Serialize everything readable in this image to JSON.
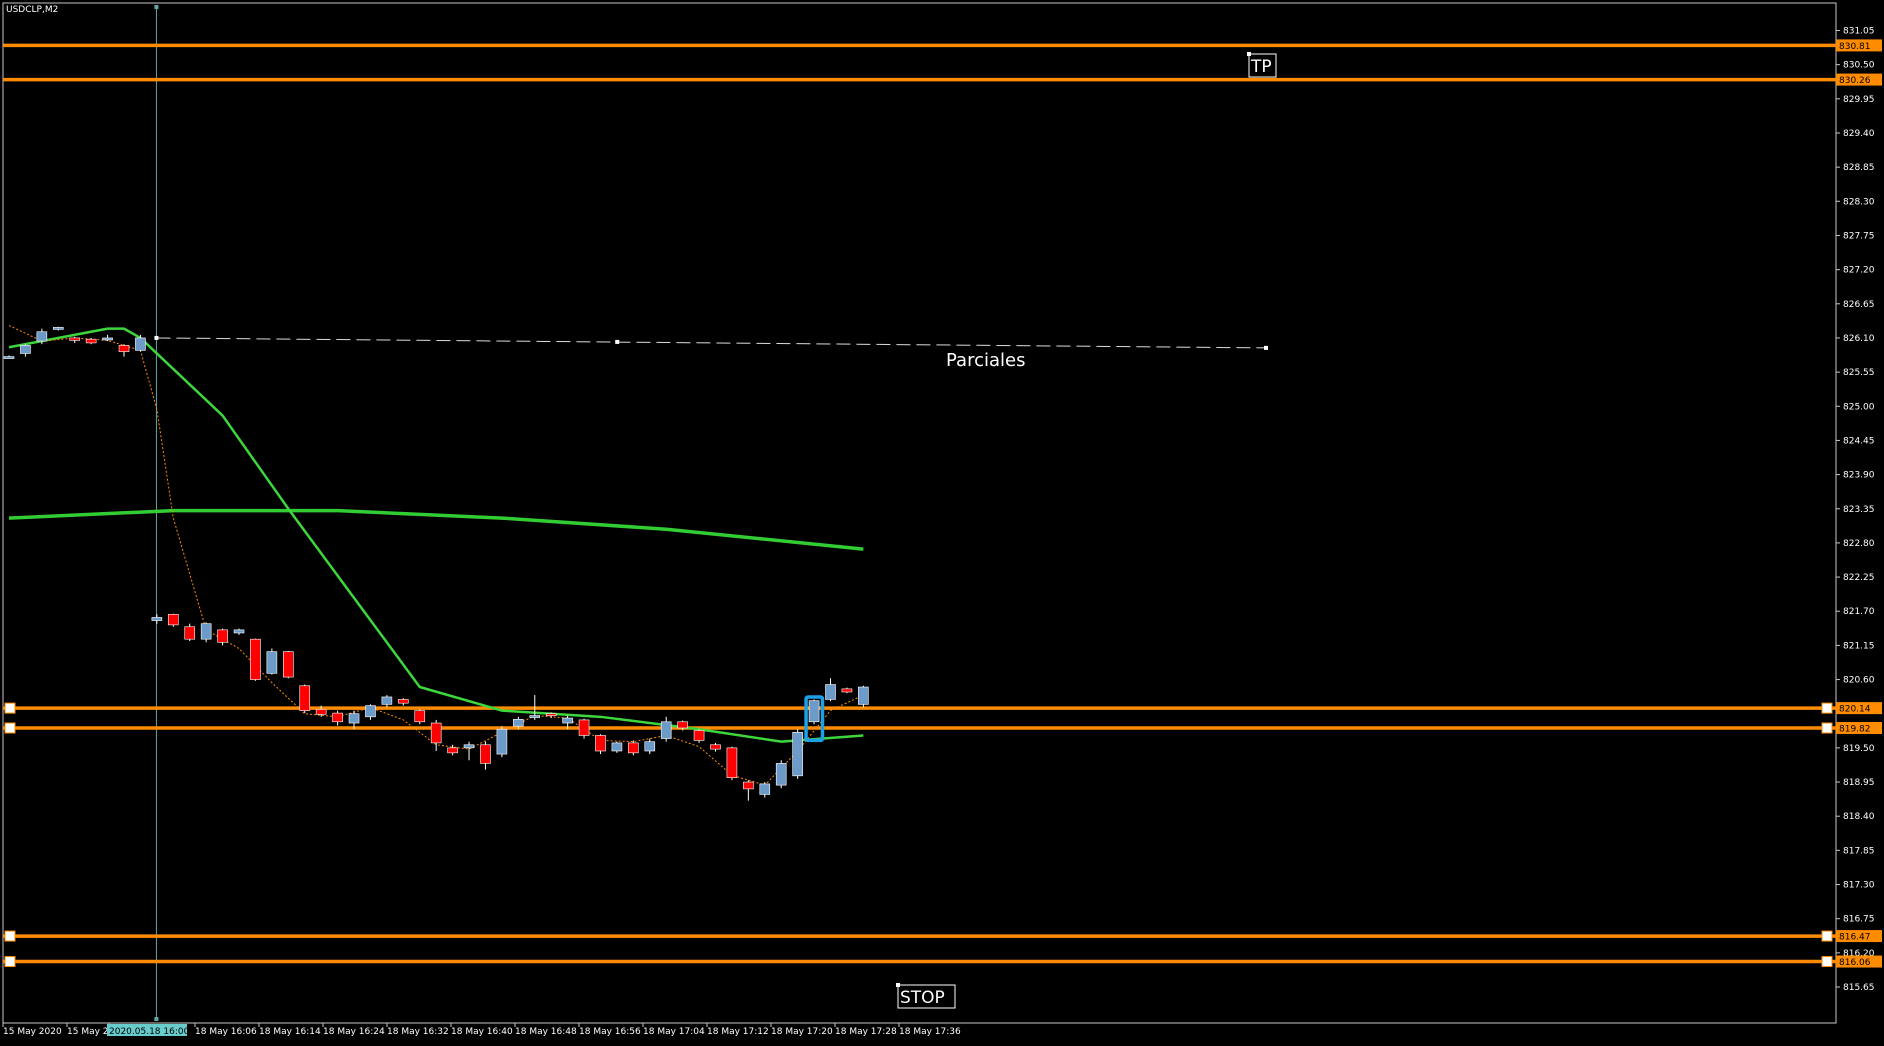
{
  "window": {
    "symbol_label": "USDCLP,M2"
  },
  "colors": {
    "background": "#000000",
    "frame": "#c8c8c8",
    "text": "#ffffff",
    "bull": "#6d9bc9",
    "bear": "#ff0000",
    "level": "#ff8c00",
    "ma_slow": "#32cd32",
    "ma_fast": "#3dd63d",
    "signal": "#ff8c00",
    "vline": "#5fa8a8",
    "trendline": "#dcdcdc",
    "highlight_box": "#1ea0e6",
    "time_highlight_bg": "#66cccc"
  },
  "chart_data": {
    "type": "candlestick",
    "y_ticks": [
      "831.05",
      "830.50",
      "829.95",
      "829.40",
      "828.85",
      "828.30",
      "827.75",
      "827.20",
      "826.65",
      "826.10",
      "825.55",
      "825.00",
      "824.45",
      "823.90",
      "823.35",
      "822.80",
      "822.25",
      "821.70",
      "821.15",
      "820.60",
      "819.50",
      "818.95",
      "818.40",
      "817.85",
      "817.30",
      "816.75",
      "816.20",
      "815.65"
    ],
    "ylim": [
      815.35,
      831.45
    ],
    "x_labels": [
      "15 May 2020",
      "15 May 2",
      "2020.05.18 16:00",
      "18 May 16:06",
      "18 May 16:14",
      "18 May 16:24",
      "18 May 16:32",
      "18 May 16:40",
      "18 May 16:48",
      "18 May 16:56",
      "18 May 17:04",
      "18 May 17:12",
      "18 May 17:20",
      "18 May 17:28",
      "18 May 17:36"
    ],
    "highlighted_time": "2020.05.18 16:00",
    "levels": [
      {
        "label": "830.81",
        "price": 830.81
      },
      {
        "label": "830.26",
        "price": 830.26
      },
      {
        "label": "820.14",
        "price": 820.14
      },
      {
        "label": "819.82",
        "price": 819.82
      },
      {
        "label": "816.47",
        "price": 816.47
      },
      {
        "label": "816.06",
        "price": 816.06
      }
    ],
    "candles": [
      {
        "o": 825.8,
        "h": 825.82,
        "l": 825.78,
        "c": 825.8
      },
      {
        "o": 825.85,
        "h": 826.0,
        "l": 825.8,
        "c": 825.98
      },
      {
        "o": 826.05,
        "h": 826.25,
        "l": 826.0,
        "c": 826.2
      },
      {
        "o": 826.25,
        "h": 826.28,
        "l": 826.22,
        "c": 826.27
      },
      {
        "o": 826.1,
        "h": 826.12,
        "l": 826.02,
        "c": 826.06
      },
      {
        "o": 826.08,
        "h": 826.1,
        "l": 826.0,
        "c": 826.02
      },
      {
        "o": 826.08,
        "h": 826.15,
        "l": 826.05,
        "c": 826.1
      },
      {
        "o": 825.98,
        "h": 826.0,
        "l": 825.8,
        "c": 825.88
      },
      {
        "o": 825.9,
        "h": 826.15,
        "l": 825.88,
        "c": 826.1
      },
      {
        "o": 821.55,
        "h": 821.65,
        "l": 821.5,
        "c": 821.6
      },
      {
        "o": 821.65,
        "h": 821.66,
        "l": 821.45,
        "c": 821.48
      },
      {
        "o": 821.45,
        "h": 821.5,
        "l": 821.22,
        "c": 821.25
      },
      {
        "o": 821.25,
        "h": 821.52,
        "l": 821.2,
        "c": 821.5
      },
      {
        "o": 821.4,
        "h": 821.42,
        "l": 821.15,
        "c": 821.2
      },
      {
        "o": 821.35,
        "h": 821.42,
        "l": 821.32,
        "c": 821.4
      },
      {
        "o": 821.25,
        "h": 821.26,
        "l": 820.58,
        "c": 820.6
      },
      {
        "o": 820.7,
        "h": 821.1,
        "l": 820.68,
        "c": 821.05
      },
      {
        "o": 821.05,
        "h": 821.06,
        "l": 820.62,
        "c": 820.64
      },
      {
        "o": 820.5,
        "h": 820.52,
        "l": 820.06,
        "c": 820.1
      },
      {
        "o": 820.12,
        "h": 820.18,
        "l": 820.0,
        "c": 820.04
      },
      {
        "o": 820.06,
        "h": 820.1,
        "l": 819.86,
        "c": 819.92
      },
      {
        "o": 819.9,
        "h": 820.1,
        "l": 819.8,
        "c": 820.05
      },
      {
        "o": 820.0,
        "h": 820.2,
        "l": 819.95,
        "c": 820.18
      },
      {
        "o": 820.2,
        "h": 820.35,
        "l": 820.15,
        "c": 820.32
      },
      {
        "o": 820.28,
        "h": 820.3,
        "l": 820.18,
        "c": 820.22
      },
      {
        "o": 820.1,
        "h": 820.12,
        "l": 819.88,
        "c": 819.92
      },
      {
        "o": 819.9,
        "h": 819.95,
        "l": 819.45,
        "c": 819.58
      },
      {
        "o": 819.5,
        "h": 819.55,
        "l": 819.38,
        "c": 819.42
      },
      {
        "o": 819.5,
        "h": 819.6,
        "l": 819.3,
        "c": 819.55
      },
      {
        "o": 819.55,
        "h": 819.6,
        "l": 819.15,
        "c": 819.25
      },
      {
        "o": 819.4,
        "h": 819.85,
        "l": 819.35,
        "c": 819.8
      },
      {
        "o": 819.85,
        "h": 820.0,
        "l": 819.8,
        "c": 819.96
      },
      {
        "o": 820.0,
        "h": 820.35,
        "l": 819.95,
        "c": 820.02
      },
      {
        "o": 820.05,
        "h": 820.07,
        "l": 819.98,
        "c": 820.03
      },
      {
        "o": 819.9,
        "h": 820.02,
        "l": 819.8,
        "c": 819.98
      },
      {
        "o": 819.95,
        "h": 819.97,
        "l": 819.65,
        "c": 819.7
      },
      {
        "o": 819.7,
        "h": 819.72,
        "l": 819.4,
        "c": 819.45
      },
      {
        "o": 819.45,
        "h": 819.6,
        "l": 819.42,
        "c": 819.58
      },
      {
        "o": 819.58,
        "h": 819.62,
        "l": 819.38,
        "c": 819.42
      },
      {
        "o": 819.45,
        "h": 819.65,
        "l": 819.4,
        "c": 819.6
      },
      {
        "o": 819.65,
        "h": 820.0,
        "l": 819.6,
        "c": 819.92
      },
      {
        "o": 819.92,
        "h": 819.94,
        "l": 819.78,
        "c": 819.82
      },
      {
        "o": 819.78,
        "h": 819.8,
        "l": 819.58,
        "c": 819.62
      },
      {
        "o": 819.55,
        "h": 819.58,
        "l": 819.44,
        "c": 819.48
      },
      {
        "o": 819.5,
        "h": 819.52,
        "l": 818.98,
        "c": 819.02
      },
      {
        "o": 818.95,
        "h": 818.98,
        "l": 818.65,
        "c": 818.84
      },
      {
        "o": 818.75,
        "h": 818.95,
        "l": 818.7,
        "c": 818.92
      },
      {
        "o": 818.9,
        "h": 819.3,
        "l": 818.85,
        "c": 819.25
      },
      {
        "o": 819.05,
        "h": 819.8,
        "l": 819.0,
        "c": 819.75
      },
      {
        "o": 819.92,
        "h": 820.28,
        "l": 819.88,
        "c": 820.26
      },
      {
        "o": 820.28,
        "h": 820.62,
        "l": 820.25,
        "c": 820.52
      },
      {
        "o": 820.45,
        "h": 820.47,
        "l": 820.38,
        "c": 820.4
      },
      {
        "o": 820.2,
        "h": 820.5,
        "l": 820.15,
        "c": 820.48
      }
    ],
    "ma_slow": {
      "x": [
        0,
        10,
        20,
        30,
        40,
        52
      ],
      "y": [
        823.2,
        823.32,
        823.32,
        823.2,
        823.02,
        822.7
      ]
    },
    "ma_fast": {
      "x": [
        0,
        6,
        7,
        8,
        13,
        17,
        25,
        30,
        36,
        42,
        47,
        52
      ],
      "y": [
        825.95,
        826.25,
        826.25,
        826.1,
        824.85,
        823.35,
        820.48,
        820.1,
        820.0,
        819.8,
        819.6,
        819.7
      ]
    },
    "signal_line": {
      "x": [
        0,
        2,
        4,
        6,
        8,
        9,
        10,
        12,
        14,
        16,
        18,
        20,
        22,
        24,
        26,
        28,
        30,
        32,
        34,
        36,
        38,
        40,
        42,
        44,
        46,
        48,
        50,
        52
      ],
      "y": [
        826.3,
        826.05,
        826.1,
        826.06,
        825.9,
        824.95,
        823.2,
        821.4,
        821.1,
        820.55,
        820.05,
        820.0,
        820.15,
        819.95,
        819.55,
        819.48,
        819.75,
        820.02,
        819.98,
        819.62,
        819.6,
        819.7,
        819.52,
        819.06,
        818.9,
        819.45,
        820.1,
        820.35
      ]
    },
    "parciales_line": {
      "x": [
        8,
        66
      ],
      "y": [
        826.1,
        825.94
      ]
    },
    "cursor_bar": 8,
    "highlight_bars": [
      49,
      50
    ],
    "annotations": {
      "tp": "TP",
      "stop": "STOP",
      "parciales": "Parciales"
    }
  }
}
